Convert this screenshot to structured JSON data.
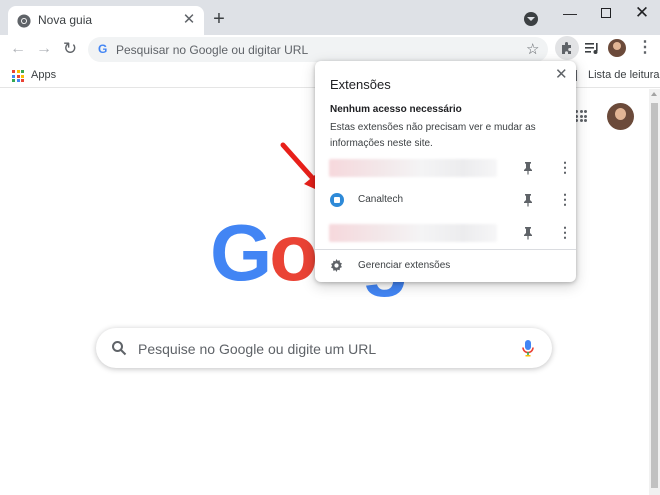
{
  "tab": {
    "title": "Nova guia",
    "close": "✕",
    "new_tab": "+"
  },
  "window": {
    "minimize": "—",
    "close": "✕"
  },
  "toolbar": {
    "back": "←",
    "forward": "→",
    "reload": "↻",
    "omnibox_g": "G",
    "omnibox_placeholder": "Pesquisar no Google ou digitar URL",
    "star": "☆",
    "menu": "⋮"
  },
  "bookmarks": {
    "apps_label": "Apps",
    "reading_list_label": "Lista de leitura",
    "apps_dot_colors": [
      "#ea4335",
      "#fbbc05",
      "#34a853",
      "#4285f4",
      "#ea4335",
      "#fbbc05",
      "#34a853",
      "#4285f4",
      "#ea4335"
    ]
  },
  "ntp": {
    "logo_letters": [
      {
        "ch": "G",
        "color": "#4285f4"
      },
      {
        "ch": "o",
        "color": "#ea4335"
      },
      {
        "ch": "o",
        "color": "#fbbc05"
      },
      {
        "ch": "g",
        "color": "#4285f4"
      }
    ],
    "search_placeholder": "Pesquise no Google ou digite um URL"
  },
  "extensions_popup": {
    "title": "Extensões",
    "close": "✕",
    "section_title": "Nenhum acesso necessário",
    "section_desc": "Estas extensões não precisam ver e mudar as informações neste site.",
    "items": [
      {
        "name": "",
        "blurred": true
      },
      {
        "name": "Canaltech",
        "blurred": false
      },
      {
        "name": "",
        "blurred": true
      }
    ],
    "more_glyph": "⋮",
    "manage_label": "Gerenciar extensões"
  },
  "colors": {
    "accent_blue": "#4285f4",
    "annotation_red": "#e8201a",
    "tabstrip_bg": "#dee1e6"
  },
  "icons": {
    "tab_favicon": "chrome-icon",
    "extensions": "puzzle-icon",
    "reading_list": "reading-list-icon",
    "search": "search-icon",
    "mic": "mic-icon",
    "pin": "pin-icon",
    "settings": "gear-icon"
  }
}
